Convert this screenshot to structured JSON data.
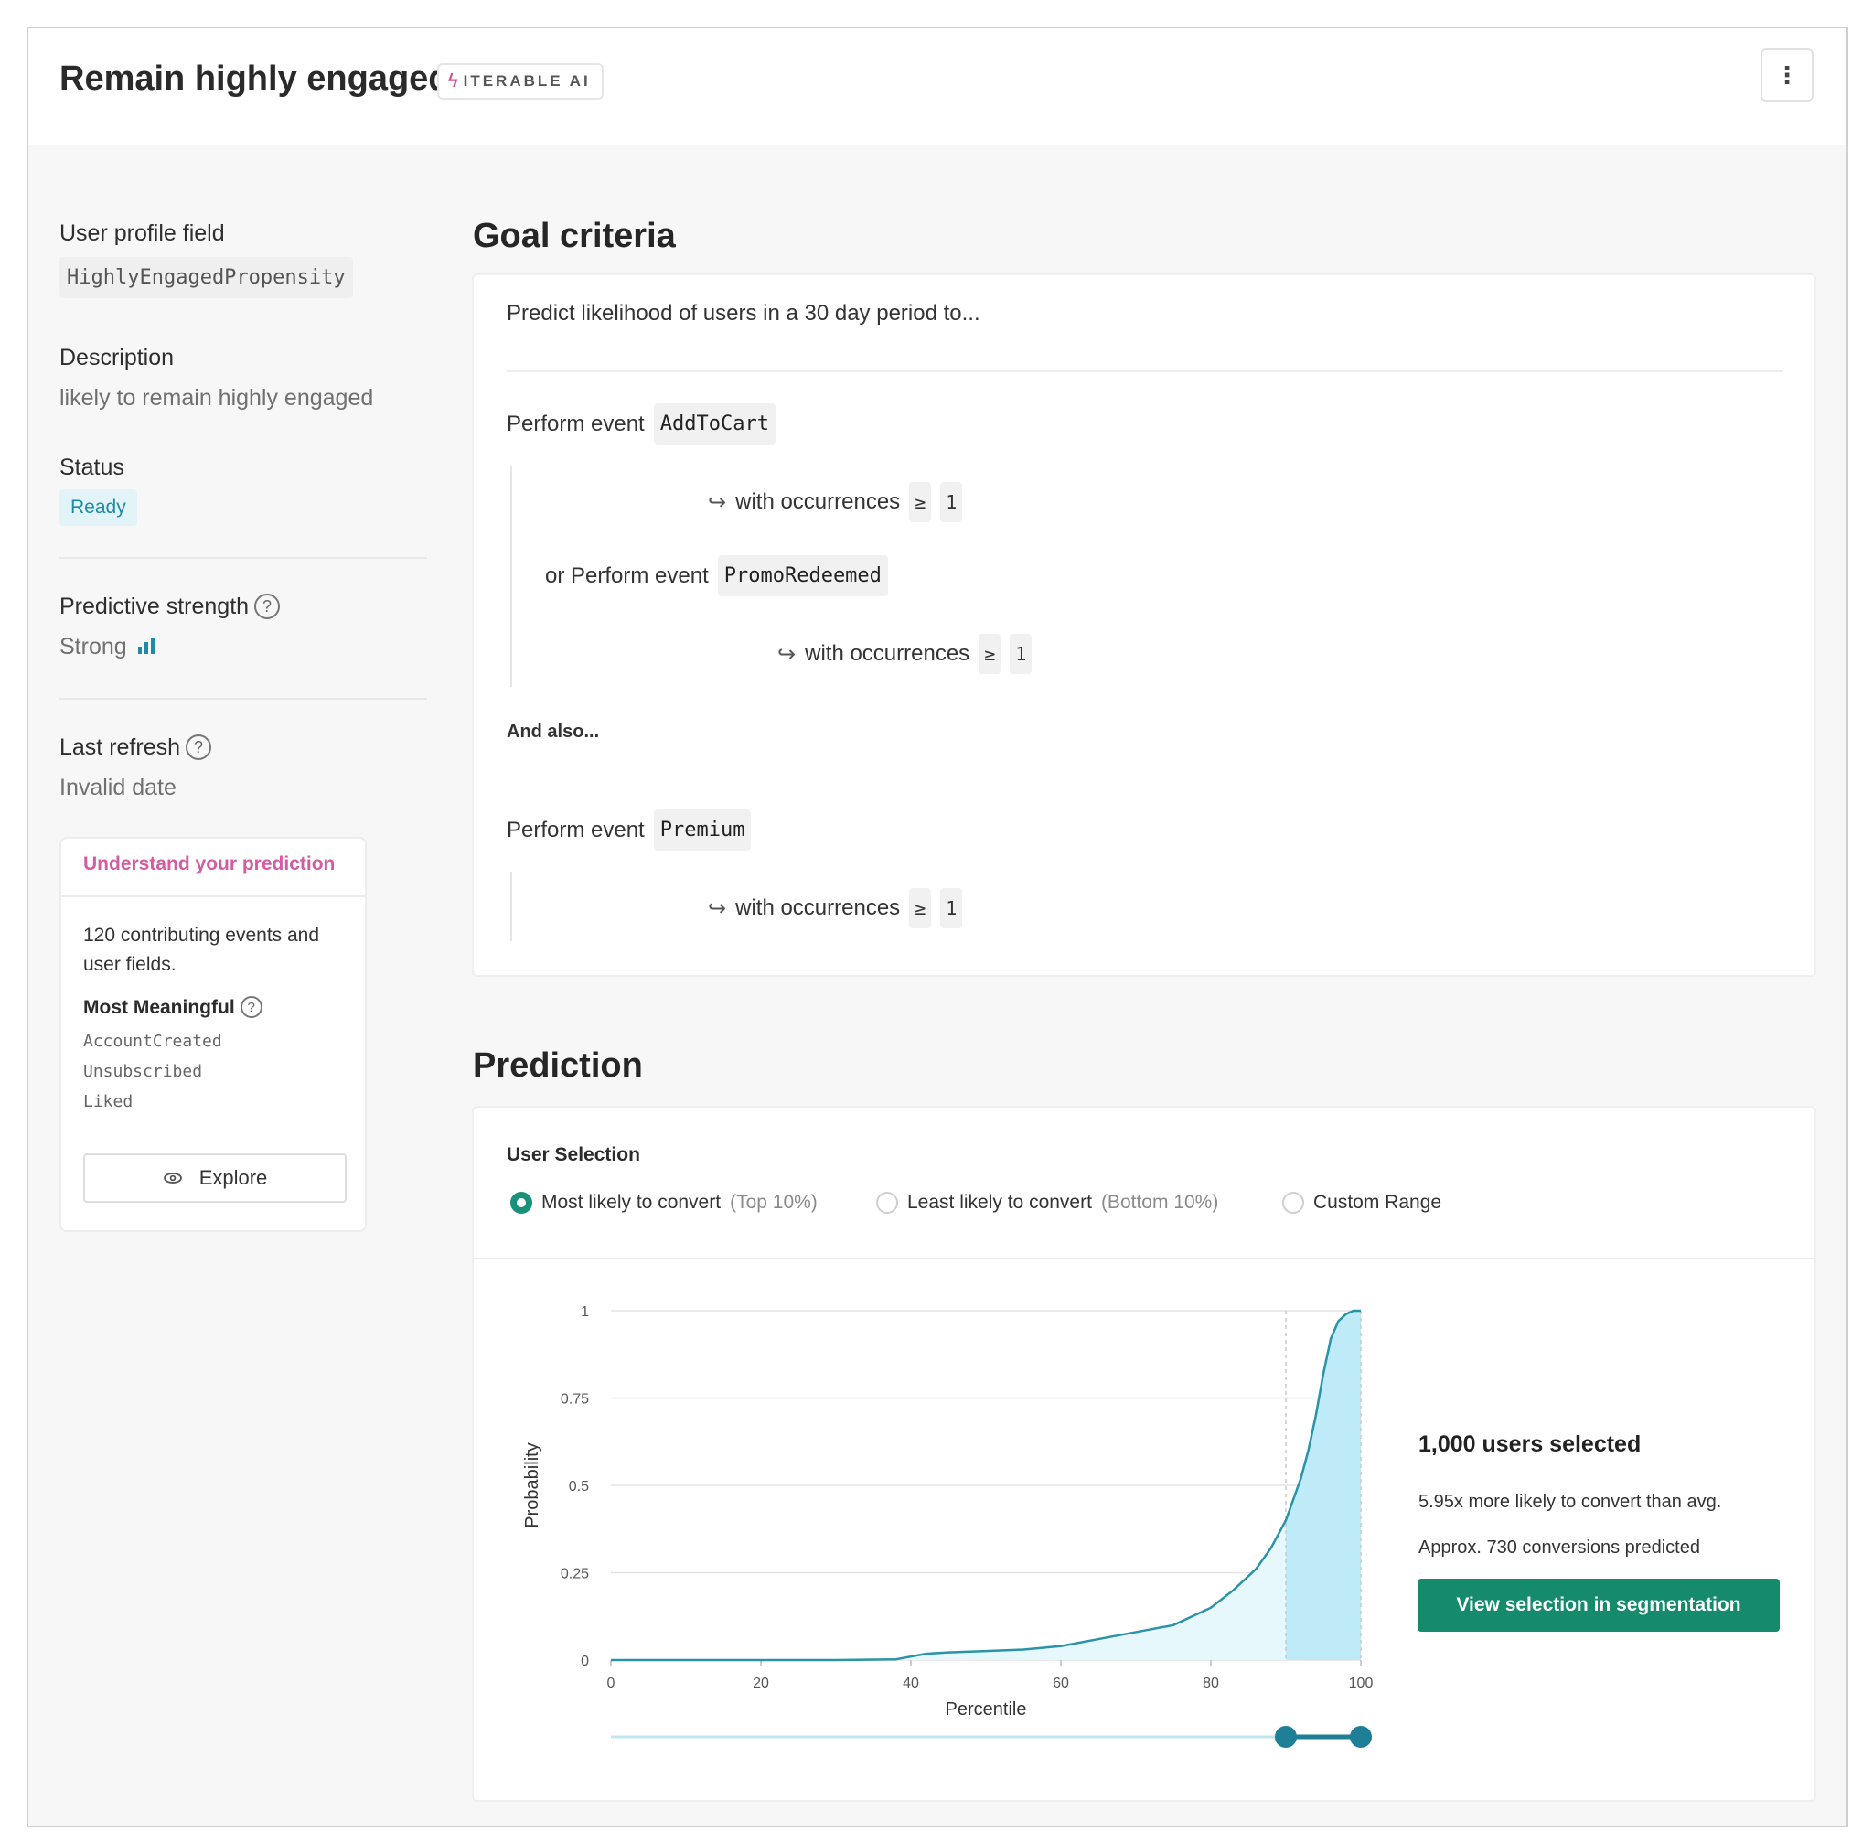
{
  "header": {
    "title": "Remain highly engaged",
    "badge": "ITERABLE AI",
    "badge_icon": "lightning-bolt-icon",
    "menu_icon": "kebab-menu-icon"
  },
  "sidebar": {
    "profile_field_label": "User profile field",
    "profile_field_value": "HighlyEngagedPropensity",
    "description_label": "Description",
    "description_value": "likely to remain highly engaged",
    "status_label": "Status",
    "status_value": "Ready",
    "strength_label": "Predictive strength",
    "strength_value": "Strong",
    "refresh_label": "Last refresh",
    "refresh_value": "Invalid date",
    "understand": {
      "title": "Understand your prediction",
      "summary": "120 contributing events and user fields.",
      "most_meaningful_label": "Most Meaningful",
      "items": [
        "AccountCreated",
        "Unsubscribed",
        "Liked"
      ],
      "explore_label": "Explore"
    }
  },
  "goal": {
    "heading": "Goal criteria",
    "intro": "Predict likelihood of users in a 30 day period to...",
    "perform_label": "Perform event",
    "or_perform_label": "or Perform event",
    "occurrences_label": "with occurrences",
    "operator": "≥",
    "event1": "AddToCart",
    "count1": "1",
    "event2": "PromoRedeemed",
    "count2": "1",
    "and_also": "And also...",
    "event3": "Premium",
    "count3": "1"
  },
  "prediction": {
    "heading": "Prediction",
    "selection_label": "User Selection",
    "options": [
      {
        "label": "Most likely to convert",
        "hint": "(Top 10%)",
        "selected": true
      },
      {
        "label": "Least likely to convert",
        "hint": "(Bottom 10%)",
        "selected": false
      },
      {
        "label": "Custom Range",
        "hint": "",
        "selected": false
      }
    ],
    "selected_count": "1,000 users selected",
    "lift_text": "5.95x more likely to convert than avg.",
    "conversions_text": "Approx. 730 conversions predicted",
    "segment_button": "View selection in segmentation",
    "range_selected": [
      90,
      100
    ]
  },
  "chart_data": {
    "type": "area",
    "xlabel": "Percentile",
    "ylabel": "Probability",
    "xlim": [
      0,
      100
    ],
    "ylim": [
      0,
      1
    ],
    "x_ticks": [
      "0",
      "20",
      "40",
      "60",
      "80",
      "100"
    ],
    "y_ticks": [
      "0",
      "0.25",
      "0.5",
      "0.75",
      "1"
    ],
    "highlight_range": [
      90,
      100
    ],
    "x": [
      0,
      10,
      20,
      30,
      38,
      40,
      42,
      45,
      50,
      55,
      60,
      65,
      70,
      75,
      80,
      83,
      86,
      88,
      90,
      92,
      93,
      94,
      95,
      96,
      97,
      98,
      99,
      100
    ],
    "y": [
      0,
      0,
      0,
      0,
      0.002,
      0.01,
      0.018,
      0.022,
      0.026,
      0.03,
      0.04,
      0.06,
      0.08,
      0.1,
      0.15,
      0.2,
      0.26,
      0.32,
      0.4,
      0.52,
      0.6,
      0.7,
      0.82,
      0.92,
      0.97,
      0.99,
      1,
      1
    ],
    "colors": {
      "line": "#2b93a7",
      "fill_light": "#e7f8fd",
      "fill_selected": "#bfeaf8",
      "accent": "#158b6c"
    }
  }
}
